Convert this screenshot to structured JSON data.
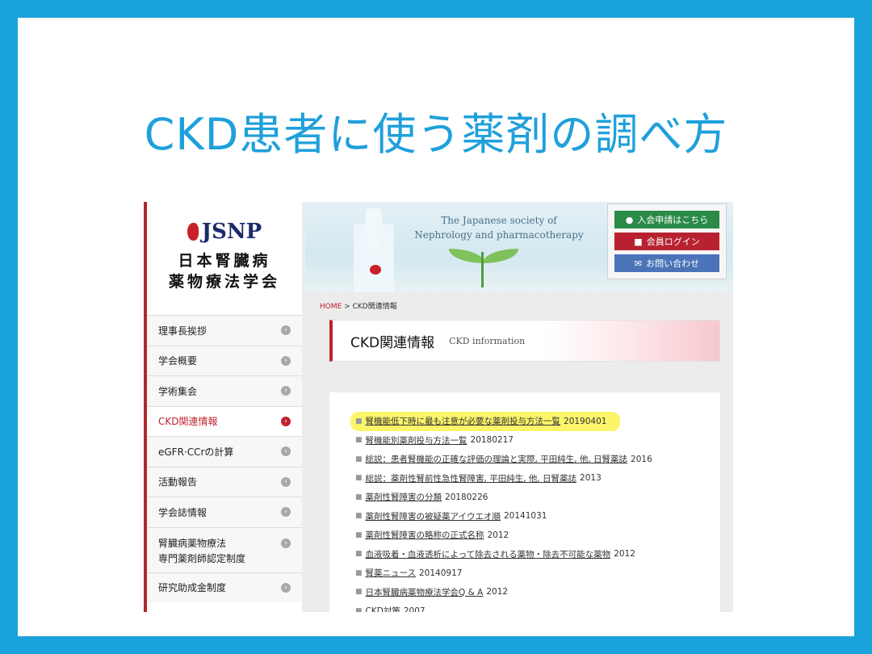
{
  "slide": {
    "title": "CKD患者に使う薬剤の調べ方"
  },
  "logo": {
    "abbr": "JSNP",
    "line1": "日本腎臓病",
    "line2": "薬物療法学会"
  },
  "nav": {
    "items": [
      {
        "label": "理事長挨拶"
      },
      {
        "label": "学会概要"
      },
      {
        "label": "学術集会"
      },
      {
        "label": "CKD関連情報",
        "active": true
      },
      {
        "label": "eGFR·CCrの計算"
      },
      {
        "label": "活動報告"
      },
      {
        "label": "学会誌情報"
      },
      {
        "label": "腎臓病薬物療法\n専門薬剤師認定制度",
        "label_line1": "腎臓病薬物療法",
        "label_line2": "専門薬剤師認定制度"
      },
      {
        "label": "研究助成金制度"
      }
    ]
  },
  "banner": {
    "line1": "The Japanese society of",
    "line2": "Nephrology and pharmacotherapy"
  },
  "buttons": {
    "join": "入会申請はこちら",
    "login": "会員ログイン",
    "contact": "お問い合わせ"
  },
  "breadcrumb": {
    "home": "HOME",
    "sep": ">",
    "current": "CKD関連情報"
  },
  "section": {
    "title_jp": "CKD関連情報",
    "title_en": "CKD information"
  },
  "links": [
    {
      "text": "腎機能低下時に最も注意が必要な薬剤投与方法一覧",
      "date": "20190401",
      "highlight": true
    },
    {
      "text": "腎機能別薬剤投与方法一覧",
      "date": "20180217"
    },
    {
      "text": "総説：患者腎機能の正確な評価の理論と実際, 平田純生, 他, 日腎薬誌",
      "date": "2016"
    },
    {
      "text": "総説：薬剤性腎前性急性腎障害, 平田純生, 他, 日腎薬誌",
      "date": "2013"
    },
    {
      "text": "薬剤性腎障害の分類",
      "date": "20180226"
    },
    {
      "text": "薬剤性腎障害の被疑薬アイウエオ順",
      "date": "20141031"
    },
    {
      "text": "薬剤性腎障害の略称の正式名称",
      "date": "2012"
    },
    {
      "text": "血液吸着・血液透析によって除去される薬物・除去不可能な薬物",
      "date": "2012"
    },
    {
      "text": "腎薬ニュース",
      "date": "20140917"
    },
    {
      "text": "日本腎臓病薬物療法学会Q & A",
      "date": "2012"
    },
    {
      "text": "CKD対策",
      "date": "2007"
    }
  ],
  "colors": {
    "frame": "#1aa3dc",
    "title": "#1fa0db",
    "accent": "#c0222c",
    "highlight": "#fbf56a"
  }
}
